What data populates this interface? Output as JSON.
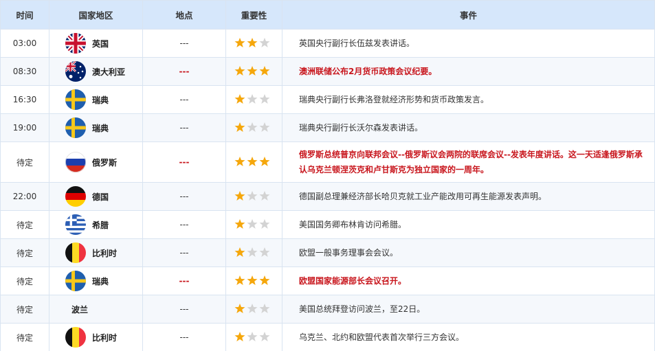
{
  "colors": {
    "header_bg": "#d6e7fb",
    "border": "#d9e4f1",
    "alt_row_bg": "#f5f8fc",
    "important_text": "#c8161d",
    "star_on": "#f5a70c",
    "star_off": "#d3d3d3"
  },
  "header": {
    "time": "时间",
    "country": "国家地区",
    "location": "地点",
    "importance": "重要性",
    "event": "事件"
  },
  "rows": [
    {
      "time": "03:00",
      "country": "英国",
      "flag_icon": "uk-flag-icon",
      "location": "---",
      "stars": 2,
      "event": "英国央行副行长伍兹发表讲话。",
      "important": false
    },
    {
      "time": "08:30",
      "country": "澳大利亚",
      "flag_icon": "australia-flag-icon",
      "location": "---",
      "stars": 3,
      "event": "澳洲联储公布2月货币政策会议纪要。",
      "important": true
    },
    {
      "time": "16:30",
      "country": "瑞典",
      "flag_icon": "sweden-flag-icon",
      "location": "---",
      "stars": 1,
      "event": "瑞典央行副行长弗洛登就经济形势和货币政策发言。",
      "important": false
    },
    {
      "time": "19:00",
      "country": "瑞典",
      "flag_icon": "sweden-flag-icon",
      "location": "---",
      "stars": 1,
      "event": "瑞典央行副行长沃尔森发表讲话。",
      "important": false
    },
    {
      "time": "待定",
      "country": "俄罗斯",
      "flag_icon": "russia-flag-icon",
      "location": "---",
      "stars": 3,
      "event": "俄罗斯总统普京向联邦会议--俄罗斯议会两院的联席会议--发表年度讲话。这一天适逢俄罗斯承认乌克兰顿涅茨克和卢甘斯克为独立国家的一周年。",
      "important": true
    },
    {
      "time": "22:00",
      "country": "德国",
      "flag_icon": "germany-flag-icon",
      "location": "---",
      "stars": 1,
      "event": "德国副总理兼经济部长哈贝克就工业产能改用可再生能源发表声明。",
      "important": false
    },
    {
      "time": "待定",
      "country": "希腊",
      "flag_icon": "greece-flag-icon",
      "location": "---",
      "stars": 1,
      "event": "美国国务卿布林肯访问希腊。",
      "important": false
    },
    {
      "time": "待定",
      "country": "比利时",
      "flag_icon": "belgium-flag-icon",
      "location": "---",
      "stars": 1,
      "event": "欧盟一般事务理事会会议。",
      "important": false
    },
    {
      "time": "待定",
      "country": "瑞典",
      "flag_icon": "sweden-flag-icon",
      "location": "---",
      "stars": 3,
      "event": "欧盟国家能源部长会议召开。",
      "important": true
    },
    {
      "time": "待定",
      "country": "波兰",
      "flag_icon": "",
      "location": "---",
      "stars": 1,
      "event": "美国总统拜登访问波兰，至22日。",
      "important": false
    },
    {
      "time": "待定",
      "country": "比利时",
      "flag_icon": "belgium-flag-icon",
      "location": "---",
      "stars": 1,
      "event": "乌克兰、北约和欧盟代表首次举行三方会议。",
      "important": false
    }
  ]
}
